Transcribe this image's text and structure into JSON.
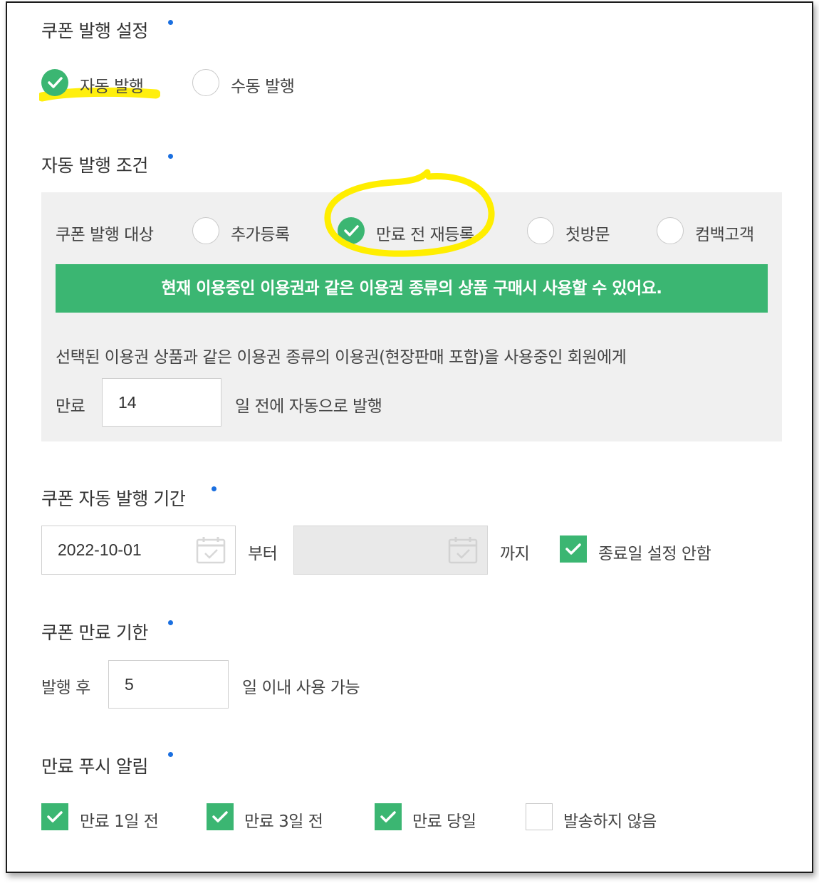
{
  "issue_setting": {
    "title": "쿠폰 발행 설정",
    "options": [
      {
        "label": "자동 발행",
        "checked": true
      },
      {
        "label": "수동 발행",
        "checked": false
      }
    ]
  },
  "auto_condition": {
    "title": "자동 발행 조건",
    "target_label": "쿠폰 발행 대상",
    "targets": [
      {
        "label": "추가등록",
        "checked": false
      },
      {
        "label": "만료 전 재등록",
        "checked": true
      },
      {
        "label": "첫방문",
        "checked": false
      },
      {
        "label": "컴백고객",
        "checked": false
      }
    ],
    "banner": "현재 이용중인 이용권과 같은 이용권 종류의 상품 구매시 사용할 수 있어요.",
    "description": "선택된 이용권 상품과 같은 이용권 종류의 이용권(현장판매 포함)을 사용중인 회원에게",
    "expiry_prefix": "만료",
    "days_value": "14",
    "expiry_suffix": "일 전에 자동으로 발행"
  },
  "period": {
    "title": "쿠폰 자동 발행 기간",
    "start_date": "2022-10-01",
    "from_label": "부터",
    "end_date": "",
    "to_label": "까지",
    "no_end_label": "종료일 설정 안함",
    "no_end_checked": true
  },
  "expiry": {
    "title": "쿠폰 만료 기한",
    "prefix": "발행 후",
    "days_value": "5",
    "suffix": "일 이내 사용 가능"
  },
  "push": {
    "title": "만료 푸시 알림",
    "options": [
      {
        "label": "만료 1일 전",
        "checked": true
      },
      {
        "label": "만료 3일 전",
        "checked": true
      },
      {
        "label": "만료 당일",
        "checked": true
      },
      {
        "label": "발송하지 않음",
        "checked": false
      }
    ]
  },
  "colors": {
    "accent_green": "#3bb672",
    "required_dot": "#1a6fe0",
    "highlight_yellow": "#ffee00",
    "panel_bg": "#f0f0f0"
  },
  "icons": [
    "check-icon",
    "calendar-icon"
  ]
}
